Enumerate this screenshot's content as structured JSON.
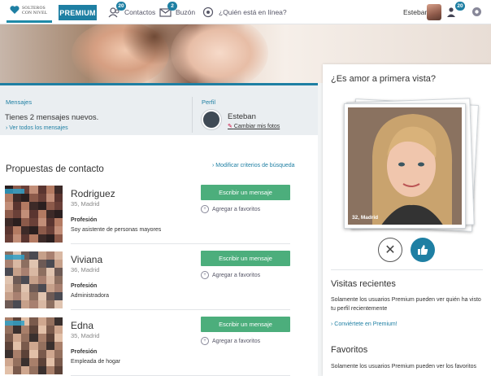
{
  "nav": {
    "logo_text": "SOLTEROS CON NIVEL",
    "premium_label": "PREMIUM",
    "contacts": {
      "label": "Contactos",
      "badge": "20"
    },
    "mailbox": {
      "label": "Buzón",
      "badge": "2"
    },
    "online": {
      "label": "¿Quién está en línea?"
    },
    "user_name": "Esteban",
    "notifications_badge": "20"
  },
  "messages": {
    "title": "Mensajes",
    "text": "Tienes 2 mensajes nuevos.",
    "link": "› Ver todos los mensajes"
  },
  "profile": {
    "title": "Perfil",
    "name": "Esteban",
    "link": "Cambiar mis fotos"
  },
  "proposals": {
    "title": "Propuestas de contacto",
    "modify_link": "› Modificar criterios de búsqueda",
    "message_button": "Escribir un mensaje",
    "favorite_label": "Agregar a favoritos",
    "profession_label": "Profesión",
    "items": [
      {
        "name": "Rodriguez",
        "location": "35, Madrid",
        "profession": "Soy asistente de personas mayores"
      },
      {
        "name": "Viviana",
        "location": "36, Madrid",
        "profession": "Administradora"
      },
      {
        "name": "Edna",
        "location": "35, Madrid",
        "profession": "Empleada de hogar"
      }
    ]
  },
  "match": {
    "title": "¿Es amor a primera vista?",
    "photo_caption": "32, Madrid"
  },
  "recent_visits": {
    "title": "Visitas recientes",
    "text": "Solamente los usuarios Premium pueden ver quién ha visto tu perfil recientemente",
    "link": "› Conviértete en Premium!"
  },
  "favorites": {
    "title": "Favoritos",
    "text": "Solamente los usuarios Premium pueden ver los favoritos"
  },
  "colors": {
    "accent": "#1e7fa3",
    "green_button": "#4cae7c"
  }
}
